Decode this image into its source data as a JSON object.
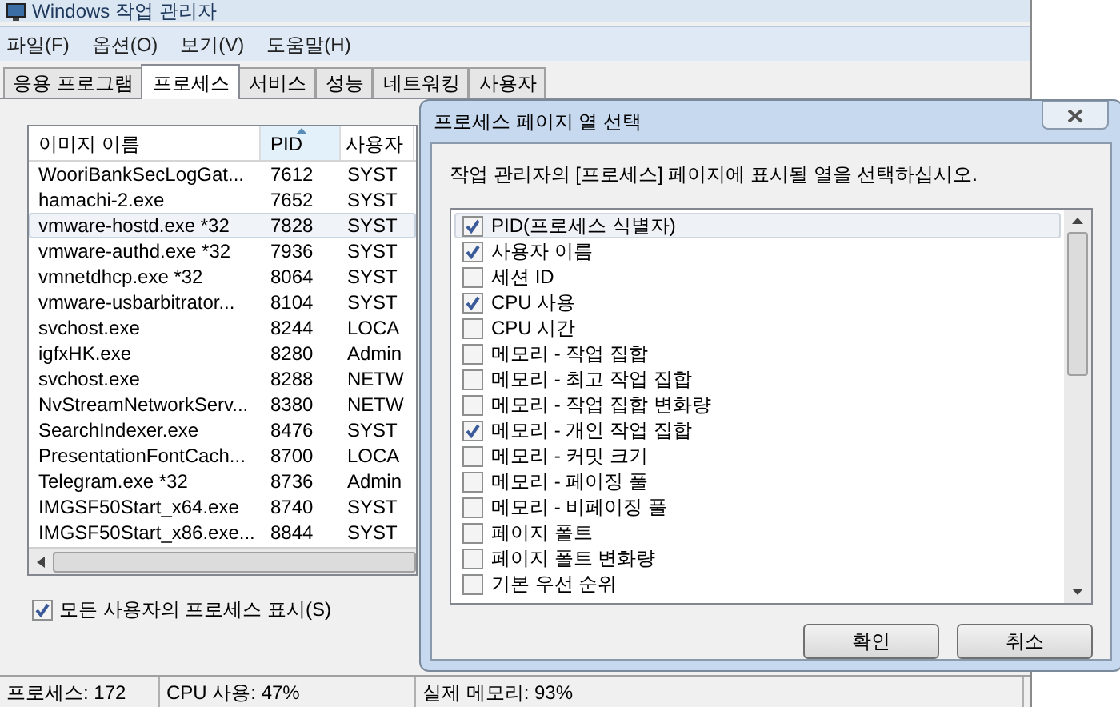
{
  "window": {
    "title": "Windows 작업 관리자"
  },
  "menu": [
    "파일(F)",
    "옵션(O)",
    "보기(V)",
    "도움말(H)"
  ],
  "tabs": [
    {
      "label": "응용 프로그램",
      "selected": false
    },
    {
      "label": "프로세스",
      "selected": true
    },
    {
      "label": "서비스",
      "selected": false
    },
    {
      "label": "성능",
      "selected": false
    },
    {
      "label": "네트워킹",
      "selected": false
    },
    {
      "label": "사용자",
      "selected": false
    }
  ],
  "process_table": {
    "columns": [
      {
        "label": "이미지 이름",
        "sorted": false
      },
      {
        "label": "PID",
        "sorted": true
      },
      {
        "label": "사용자",
        "sorted": false
      }
    ],
    "rows": [
      {
        "image": "WooriBankSecLogGat...",
        "pid": "7612",
        "user": "SYST",
        "selected": false
      },
      {
        "image": "hamachi-2.exe",
        "pid": "7652",
        "user": "SYST",
        "selected": false
      },
      {
        "image": "vmware-hostd.exe *32",
        "pid": "7828",
        "user": "SYST",
        "selected": true
      },
      {
        "image": "vmware-authd.exe *32",
        "pid": "7936",
        "user": "SYST",
        "selected": false
      },
      {
        "image": "vmnetdhcp.exe *32",
        "pid": "8064",
        "user": "SYST",
        "selected": false
      },
      {
        "image": "vmware-usbarbitrator...",
        "pid": "8104",
        "user": "SYST",
        "selected": false
      },
      {
        "image": "svchost.exe",
        "pid": "8244",
        "user": "LOCA",
        "selected": false
      },
      {
        "image": "igfxHK.exe",
        "pid": "8280",
        "user": "Admin",
        "selected": false
      },
      {
        "image": "svchost.exe",
        "pid": "8288",
        "user": "NETW",
        "selected": false
      },
      {
        "image": "NvStreamNetworkServ...",
        "pid": "8380",
        "user": "NETW",
        "selected": false
      },
      {
        "image": "SearchIndexer.exe",
        "pid": "8476",
        "user": "SYST",
        "selected": false
      },
      {
        "image": "PresentationFontCach...",
        "pid": "8700",
        "user": "LOCA",
        "selected": false
      },
      {
        "image": "Telegram.exe *32",
        "pid": "8736",
        "user": "Admin",
        "selected": false
      },
      {
        "image": "IMGSF50Start_x64.exe",
        "pid": "8740",
        "user": "SYST",
        "selected": false
      },
      {
        "image": "IMGSF50Start_x86.exe...",
        "pid": "8844",
        "user": "SYST",
        "selected": false
      }
    ]
  },
  "show_all_users": {
    "label": "모든 사용자의 프로세스 표시(S)",
    "checked": true
  },
  "status_bar": [
    "프로세스: 172",
    "CPU 사용: 47%",
    "실제 메모리: 93%"
  ],
  "dialog": {
    "title": "프로세스 페이지 열 선택",
    "instruction": "작업 관리자의 [프로세스] 페이지에 표시될 열을 선택하십시오.",
    "options": [
      {
        "label": "PID(프로세스 식별자)",
        "checked": true,
        "selected": true
      },
      {
        "label": "사용자 이름",
        "checked": true,
        "selected": false
      },
      {
        "label": "세션 ID",
        "checked": false,
        "selected": false
      },
      {
        "label": "CPU 사용",
        "checked": true,
        "selected": false
      },
      {
        "label": "CPU 시간",
        "checked": false,
        "selected": false
      },
      {
        "label": "메모리 - 작업 집합",
        "checked": false,
        "selected": false
      },
      {
        "label": "메모리 - 최고 작업 집합",
        "checked": false,
        "selected": false
      },
      {
        "label": "메모리 - 작업 집합 변화량",
        "checked": false,
        "selected": false
      },
      {
        "label": "메모리 - 개인 작업 집합",
        "checked": true,
        "selected": false
      },
      {
        "label": "메모리 - 커밋 크기",
        "checked": false,
        "selected": false
      },
      {
        "label": "메모리 - 페이징 풀",
        "checked": false,
        "selected": false
      },
      {
        "label": "메모리 - 비페이징 풀",
        "checked": false,
        "selected": false
      },
      {
        "label": "페이지 폴트",
        "checked": false,
        "selected": false
      },
      {
        "label": "페이지 폴트 변화량",
        "checked": false,
        "selected": false
      },
      {
        "label": "기본 우선 순위",
        "checked": false,
        "selected": false
      }
    ],
    "buttons": [
      "확인",
      "취소"
    ]
  }
}
